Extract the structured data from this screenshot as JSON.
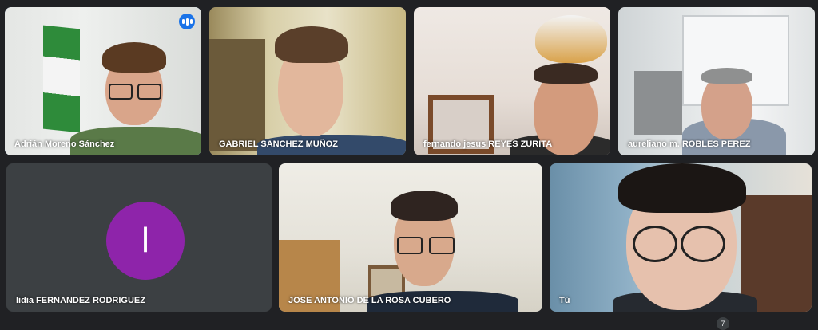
{
  "participants": [
    {
      "name": "Adrián Moreno Sánchez",
      "speaking": true
    },
    {
      "name": "GABRIEL SANCHEZ MUÑOZ"
    },
    {
      "name": "fernando jesus REYES ZURITA"
    },
    {
      "name": "aureliano m. ROBLES PEREZ"
    },
    {
      "name": "lidia FERNANDEZ RODRIGUEZ",
      "avatar_letter": "l",
      "avatar_color": "#8e24aa"
    },
    {
      "name": "JOSE ANTONIO DE LA ROSA CUBERO"
    },
    {
      "name": "Tú"
    }
  ],
  "hidden_count": "7",
  "colors": {
    "background": "#202124",
    "active_border": "#8ab4f8",
    "speaking_badge": "#1a73e8"
  }
}
